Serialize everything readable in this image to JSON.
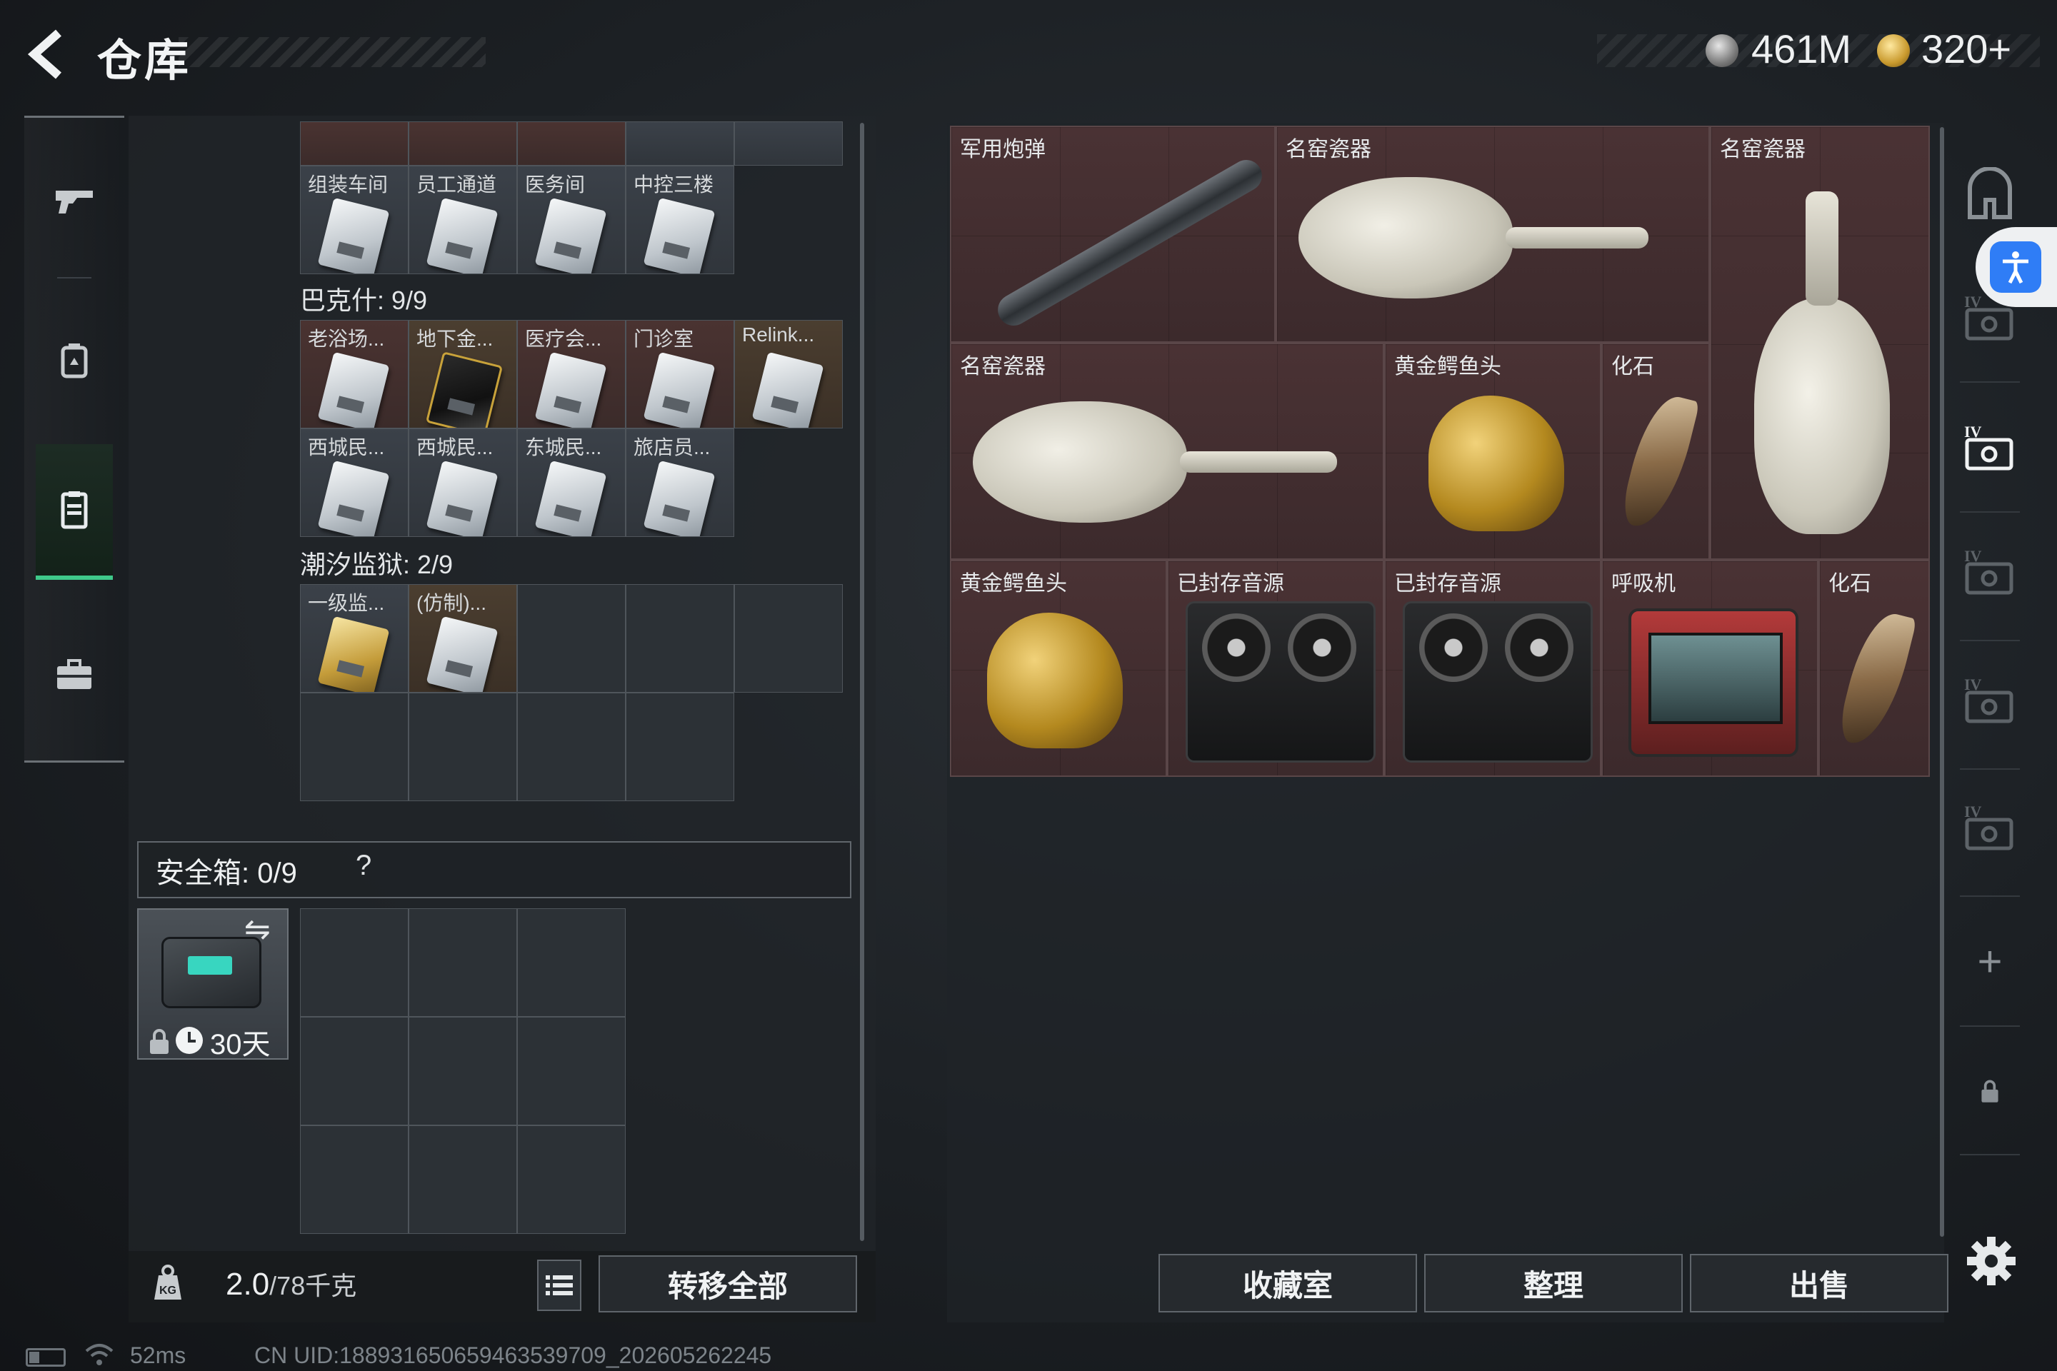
{
  "header": {
    "title": "仓库",
    "currency_silver": "461M",
    "currency_gold": "320+"
  },
  "left_rail": {
    "items": [
      {
        "name": "weapons",
        "icon": "pistol-icon"
      },
      {
        "name": "backpack",
        "icon": "backpack-icon"
      },
      {
        "name": "keycards",
        "icon": "keycard-holder-icon",
        "active": true
      },
      {
        "name": "case",
        "icon": "briefcase-icon"
      }
    ]
  },
  "keycards": {
    "row0_labels": [
      "组装车间",
      "员工通道",
      "医务间",
      "中控三楼"
    ],
    "bakshi_title": "巴克什: 9/9",
    "bakshi_row1": [
      "老浴场...",
      "地下金...",
      "医疗会...",
      "门诊室",
      "Relink..."
    ],
    "bakshi_row2": [
      "西城民...",
      "西城民...",
      "东城民...",
      "旅店员..."
    ],
    "prison_title": "潮汐监狱: 2/9",
    "prison_row1": [
      "一级监...",
      "(仿制)..."
    ]
  },
  "safebox": {
    "label": "安全箱:  0/9",
    "help": "?",
    "swap_icon": "⇋",
    "timer": "30天"
  },
  "footer_left": {
    "weight_value": "2.0",
    "weight_unit": "/78千克",
    "transfer_all": "转移全部"
  },
  "stash": {
    "items": [
      {
        "label": "军用炮弹",
        "icon": "missile"
      },
      {
        "label": "名窑瓷器",
        "icon": "porcelain-vase-horizontal"
      },
      {
        "label": "名窑瓷器",
        "icon": "porcelain-vase-vertical"
      },
      {
        "label": "名窑瓷器",
        "icon": "porcelain-vase-horizontal"
      },
      {
        "label": "黄金鳄鱼头",
        "icon": "golden-crocodile-head"
      },
      {
        "label": "化石",
        "icon": "fossil-claw"
      },
      {
        "label": "黄金鳄鱼头",
        "icon": "golden-crocodile-head"
      },
      {
        "label": "已封存音源",
        "icon": "reel-to-reel-recorder"
      },
      {
        "label": "已封存音源",
        "icon": "reel-to-reel-recorder"
      },
      {
        "label": "呼吸机",
        "icon": "ventilator"
      },
      {
        "label": "化石",
        "icon": "fossil-claw"
      }
    ],
    "item_background": "#4a3234"
  },
  "actions": {
    "collection": "收藏室",
    "organize": "整理",
    "sell": "出售"
  },
  "right_rail": {
    "tab_roman": "IV",
    "add": "+"
  },
  "status": {
    "ping": "52ms",
    "uid": "CN UID:18893165065946353970​9_202605262245"
  },
  "colors": {
    "accent_green": "#3fc98a",
    "accessibility_blue": "#2f7df6"
  }
}
